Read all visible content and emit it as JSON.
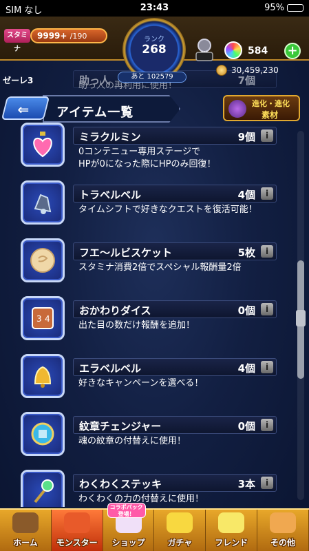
{
  "status_bar": {
    "carrier": "SIM なし",
    "time": "23:43",
    "battery": "95%"
  },
  "top_bar": {
    "stamina_label": "スタミナ",
    "stamina_value": "9999+",
    "stamina_max": "/190",
    "rank_label": "ランク",
    "rank_value": "268",
    "exp_text": "あと 102579",
    "monster_slot_label": "---",
    "orb_count": "584",
    "add_label": "+",
    "coins": "30,459,230"
  },
  "header": {
    "back_label": "⇐",
    "title": "アイテム一覧",
    "evolution_line1": "進化・進化",
    "evolution_line2": "素材"
  },
  "side_label": "ゼーレ3",
  "partial_item": {
    "name": "助っ人",
    "count": "7個",
    "desc": "助っ人の再利用に使用！"
  },
  "items": [
    {
      "name": "ミラクルミン",
      "count": "9個",
      "desc": "0コンテニュー専用ステージで\nHPが0になった際にHPのみ回復！",
      "icon": "heart-potion-icon"
    },
    {
      "name": "トラベルベル",
      "count": "4個",
      "desc": "タイムシフトで好きなクエストを復活可能！",
      "icon": "travel-bell-icon"
    },
    {
      "name": "フエ〜ルビスケット",
      "count": "5枚",
      "desc": "スタミナ消費2倍でスペシャル報酬量2倍",
      "icon": "biscuit-icon"
    },
    {
      "name": "おかわりダイス",
      "count": "0個",
      "desc": "出た目の数だけ報酬を追加！",
      "icon": "dice-icon"
    },
    {
      "name": "エラベルベル",
      "count": "4個",
      "desc": "好きなキャンペーンを選べる！",
      "icon": "gold-bell-icon"
    },
    {
      "name": "紋章チェンジャー",
      "count": "0個",
      "desc": "魂の紋章の付替えに使用！",
      "icon": "crest-changer-icon"
    },
    {
      "name": "わくわくステッキ",
      "count": "3本",
      "desc": "わくわくの力の付替えに使用！",
      "icon": "magic-wand-icon"
    }
  ],
  "info_label": "i",
  "nav": [
    {
      "label": "ホーム",
      "icon": "home-icon"
    },
    {
      "label": "モンスター",
      "icon": "monster-icon"
    },
    {
      "label": "ショップ",
      "icon": "shop-icon",
      "badge": "コラボパック登場！"
    },
    {
      "label": "ガチャ",
      "icon": "gacha-icon"
    },
    {
      "label": "フレンド",
      "icon": "friend-icon"
    },
    {
      "label": "その他",
      "icon": "other-icon"
    }
  ]
}
